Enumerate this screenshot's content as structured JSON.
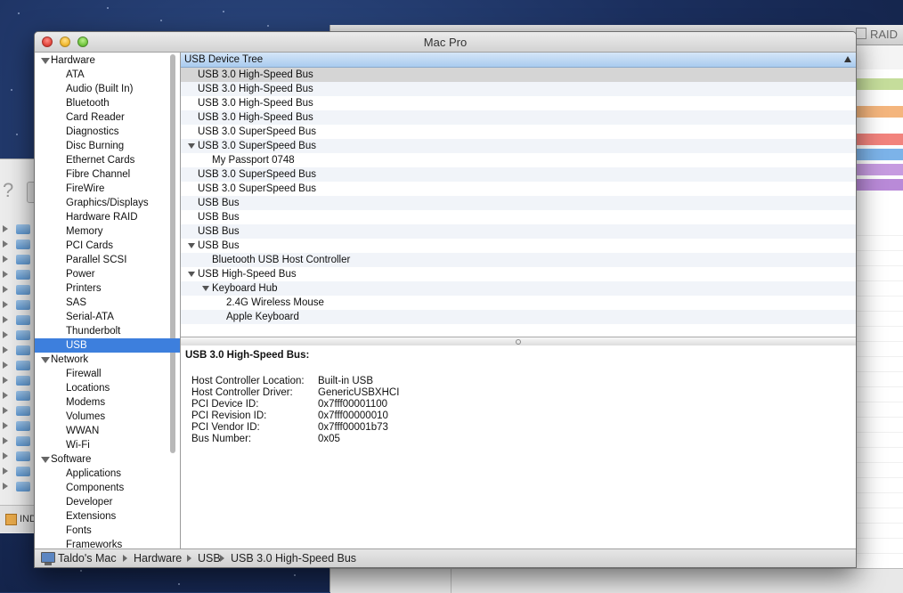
{
  "window": {
    "title": "Mac Pro"
  },
  "background_window": {
    "title": "RAID",
    "band_colors": [
      "#c5dd9b",
      "#f4b57d",
      "#f2837d",
      "#7cb3e9",
      "#c69be0",
      "#b98ad8"
    ]
  },
  "left_window": {
    "help_label": "?",
    "bottom_label": "IND"
  },
  "sidebar": {
    "hardware": {
      "label": "Hardware",
      "items": [
        "ATA",
        "Audio (Built In)",
        "Bluetooth",
        "Card Reader",
        "Diagnostics",
        "Disc Burning",
        "Ethernet Cards",
        "Fibre Channel",
        "FireWire",
        "Graphics/Displays",
        "Hardware RAID",
        "Memory",
        "PCI Cards",
        "Parallel SCSI",
        "Power",
        "Printers",
        "SAS",
        "Serial-ATA",
        "Thunderbolt",
        "USB"
      ]
    },
    "network": {
      "label": "Network",
      "items": [
        "Firewall",
        "Locations",
        "Modems",
        "Volumes",
        "WWAN",
        "Wi-Fi"
      ]
    },
    "software": {
      "label": "Software",
      "items": [
        "Applications",
        "Components",
        "Developer",
        "Extensions",
        "Fonts",
        "Frameworks"
      ]
    },
    "selected": "USB"
  },
  "tree": {
    "header": "USB Device Tree",
    "rows": [
      {
        "label": "USB 3.0 High-Speed Bus",
        "level": 0,
        "expanded": false
      },
      {
        "label": "USB 3.0 High-Speed Bus",
        "level": 0,
        "expanded": false
      },
      {
        "label": "USB 3.0 High-Speed Bus",
        "level": 0,
        "expanded": false
      },
      {
        "label": "USB 3.0 High-Speed Bus",
        "level": 0,
        "expanded": false
      },
      {
        "label": "USB 3.0 SuperSpeed Bus",
        "level": 0,
        "expanded": false
      },
      {
        "label": "USB 3.0 SuperSpeed Bus",
        "level": 0,
        "expanded": true
      },
      {
        "label": "My Passport 0748",
        "level": 1,
        "expanded": false
      },
      {
        "label": "USB 3.0 SuperSpeed Bus",
        "level": 0,
        "expanded": false
      },
      {
        "label": "USB 3.0 SuperSpeed Bus",
        "level": 0,
        "expanded": false
      },
      {
        "label": "USB Bus",
        "level": 0,
        "expanded": false
      },
      {
        "label": "USB Bus",
        "level": 0,
        "expanded": false
      },
      {
        "label": "USB Bus",
        "level": 0,
        "expanded": false
      },
      {
        "label": "USB Bus",
        "level": 0,
        "expanded": true
      },
      {
        "label": "Bluetooth USB Host Controller",
        "level": 1,
        "expanded": false
      },
      {
        "label": "USB High-Speed Bus",
        "level": 0,
        "expanded": true
      },
      {
        "label": "Keyboard Hub",
        "level": 1,
        "expanded": true
      },
      {
        "label": "2.4G Wireless Mouse",
        "level": 2,
        "expanded": false
      },
      {
        "label": "Apple Keyboard",
        "level": 2,
        "expanded": false
      }
    ],
    "selected_index": 0
  },
  "detail": {
    "heading": "USB 3.0 High-Speed Bus:",
    "properties": [
      {
        "key": "Host Controller Location:",
        "value": "Built-in USB"
      },
      {
        "key": "Host Controller Driver:",
        "value": "GenericUSBXHCI"
      },
      {
        "key": "PCI Device ID:",
        "value": "0x7fff00001100"
      },
      {
        "key": "PCI Revision ID:",
        "value": "0x7fff00000010"
      },
      {
        "key": "PCI Vendor ID:",
        "value": "0x7fff00001b73"
      },
      {
        "key": "Bus Number:",
        "value": "0x05"
      }
    ]
  },
  "status_bar": {
    "path": [
      "Taldo's Mac",
      "Hardware",
      "USB",
      "USB 3.0 High-Speed Bus"
    ]
  },
  "colors": {
    "selection": "#3d7fdd",
    "header": "#a9cbef"
  }
}
